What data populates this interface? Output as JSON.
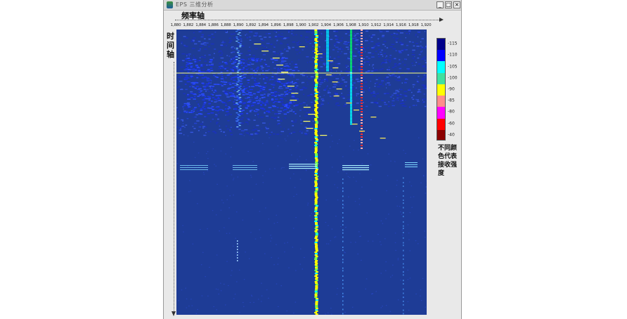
{
  "window": {
    "title": "EPS 三维分析",
    "controls": {
      "minimize": "_",
      "maximize": "□",
      "close": "×"
    }
  },
  "axes": {
    "frequency_label": "频率轴",
    "time_label": "时间轴",
    "frequency_ticks": [
      "1,880",
      "1,882",
      "1,884",
      "1,886",
      "1,888",
      "1,890",
      "1,892",
      "1,894",
      "1,896",
      "1,898",
      "1,900",
      "1,902",
      "1,904",
      "1,906",
      "1,908",
      "1,910",
      "1,912",
      "1,914",
      "1,916",
      "1,918",
      "1,920"
    ]
  },
  "colorbar": {
    "levels": [
      {
        "value": "-115",
        "color": "#00008b"
      },
      {
        "value": "-110",
        "color": "#0000ff"
      },
      {
        "value": "-105",
        "color": "#00ffff"
      },
      {
        "value": "-100",
        "color": "#40e0a0"
      },
      {
        "value": "-90",
        "color": "#ffff00"
      },
      {
        "value": "-85",
        "color": "#ff8c8c"
      },
      {
        "value": "-80",
        "color": "#ff00ff"
      },
      {
        "value": "-60",
        "color": "#ff0000"
      },
      {
        "value": "-40",
        "color": "#8b0000"
      }
    ],
    "note": "不同颜色代表接收强度"
  },
  "colors": {
    "background": "#1e3c96",
    "strong_signal": "#ffff00",
    "medium_signal": "#00ffff",
    "marker_line": "#ffff80"
  }
}
